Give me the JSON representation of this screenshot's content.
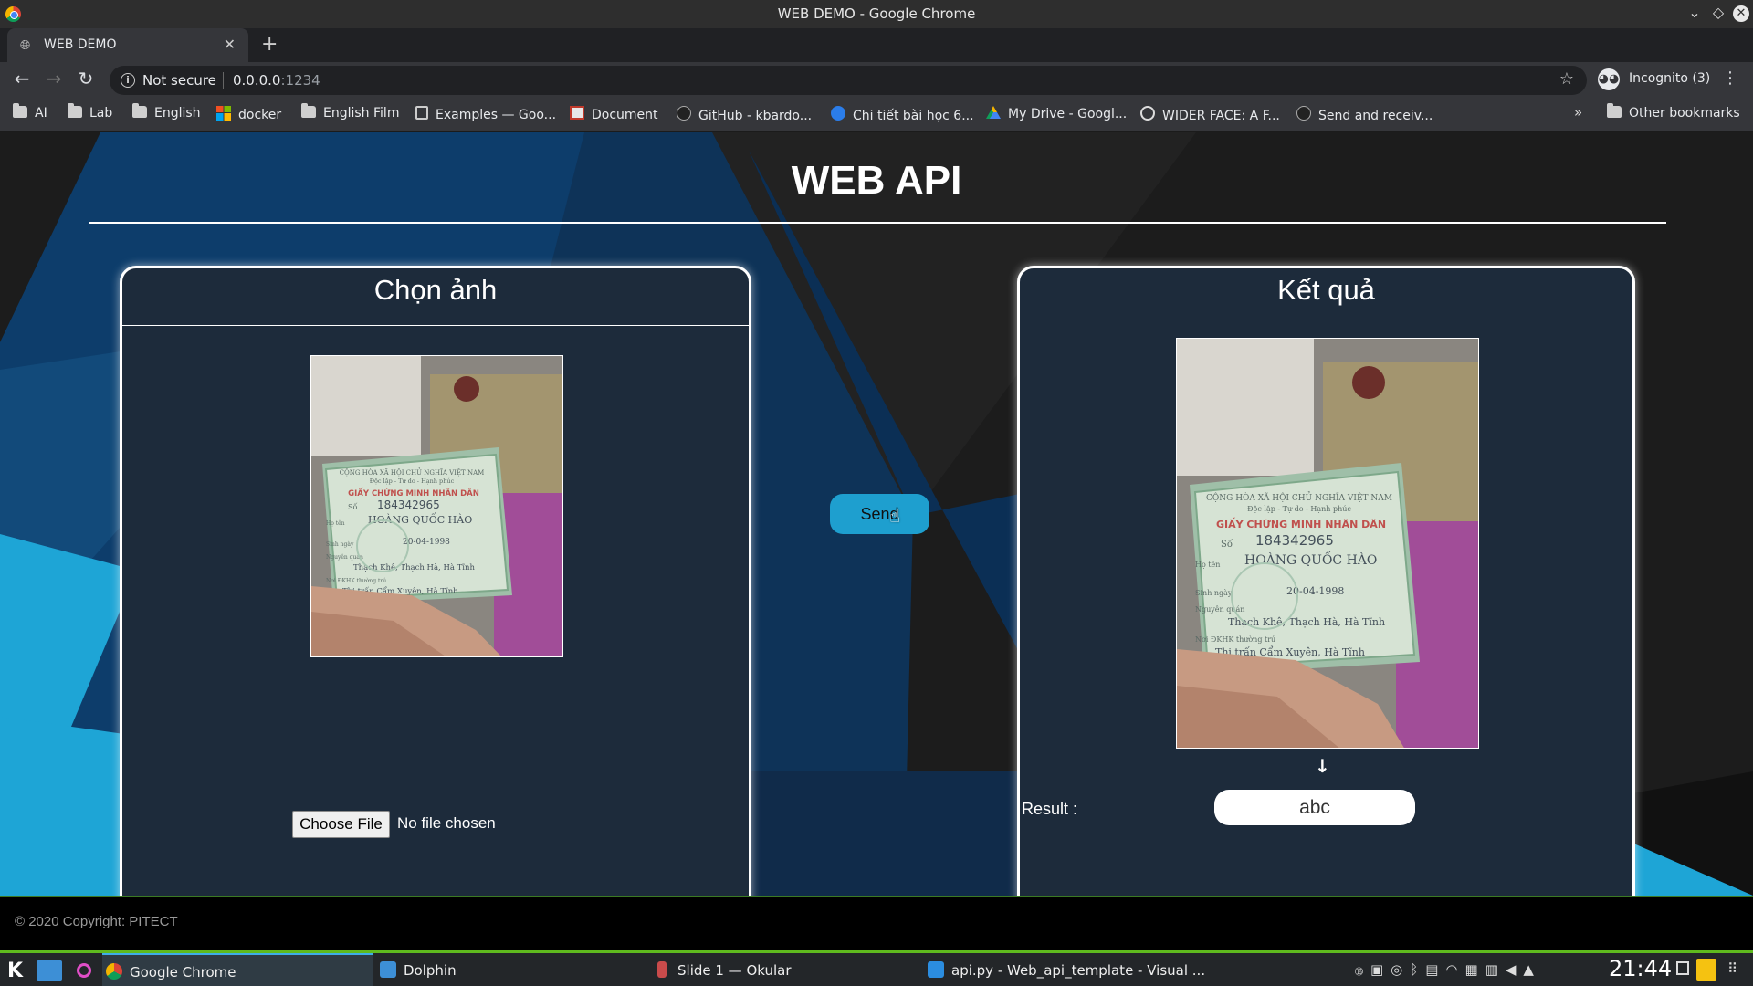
{
  "window": {
    "title": "WEB DEMO - Google Chrome"
  },
  "tab": {
    "title": "WEB DEMO",
    "close": "✕",
    "new_tab": "+"
  },
  "toolbar": {
    "back": "←",
    "forward": "→",
    "reload": "↻",
    "security_text": "Not secure",
    "url_host": "0.0.0.0",
    "url_port": ":1234",
    "profile_label": "Incognito (3)"
  },
  "bookmarks": {
    "items": [
      {
        "label": "AI",
        "icon": "folder-icon"
      },
      {
        "label": "Lab",
        "icon": "folder-icon"
      },
      {
        "label": "English",
        "icon": "folder-icon"
      },
      {
        "label": "docker",
        "icon": "windows-icon"
      },
      {
        "label": "English Film",
        "icon": "folder-icon"
      },
      {
        "label": "Examples — Goo...",
        "icon": "doc-icon"
      },
      {
        "label": "Document",
        "icon": "doc-icon"
      },
      {
        "label": "GitHub - kbardo...",
        "icon": "github-icon"
      },
      {
        "label": "Chi tiết bài học 6...",
        "icon": "site-icon"
      },
      {
        "label": "My Drive - Googl...",
        "icon": "drive-icon"
      },
      {
        "label": "WIDER FACE: A F...",
        "icon": "globe-icon"
      },
      {
        "label": "Send and receiv...",
        "icon": "github-icon"
      }
    ],
    "overflow": "»",
    "other": "Other bookmarks"
  },
  "page": {
    "title": "WEB API",
    "left_panel": {
      "heading": "Chọn ảnh",
      "choose_file_label": "Choose File",
      "file_status": "No file chosen"
    },
    "send_label": "Send",
    "right_panel": {
      "heading": "Kết quả",
      "arrow": "↓",
      "result_label": "Result :",
      "result_value": "abc"
    },
    "footer": "© 2020 Copyright: PITECT"
  },
  "id_card": {
    "line1": "CỘNG HÒA XÃ HỘI CHỦ NGHĨA VIỆT NAM",
    "line2": "Độc lập - Tự do - Hạnh phúc",
    "title": "GIẤY CHỨNG MINH NHÂN DÂN",
    "number_label": "Số",
    "number": "184342965",
    "name_label": "Họ tên",
    "name": "HOÀNG QUỐC HÀO",
    "dob_label": "Sinh ngày",
    "dob": "20-04-1998",
    "origin_label": "Nguyên quán",
    "origin": "Thạch Khê, Thạch Hà, Hà Tĩnh",
    "residence_label": "Nơi ĐKHK thường trú",
    "residence": "Thị trấn Cẩm Xuyên, Hà Tĩnh"
  },
  "taskbar": {
    "items": [
      {
        "label": "Google Chrome",
        "icon": "chrome-icon",
        "active": true
      },
      {
        "label": "Dolphin",
        "icon": "dolphin-icon"
      },
      {
        "label": "Slide 1 — Okular",
        "icon": "okular-icon"
      },
      {
        "label": "api.py - Web_api_template - Visual ...",
        "icon": "vscode-icon"
      }
    ],
    "clock": "21:44"
  },
  "colors": {
    "page_dark": "#1c1c1c",
    "panel_bg": "#1d2b3b",
    "send_button": "#1e9fcf",
    "bg_blue_dark": "#0d3d6b",
    "bg_blue_light": "#1ea5d6"
  }
}
